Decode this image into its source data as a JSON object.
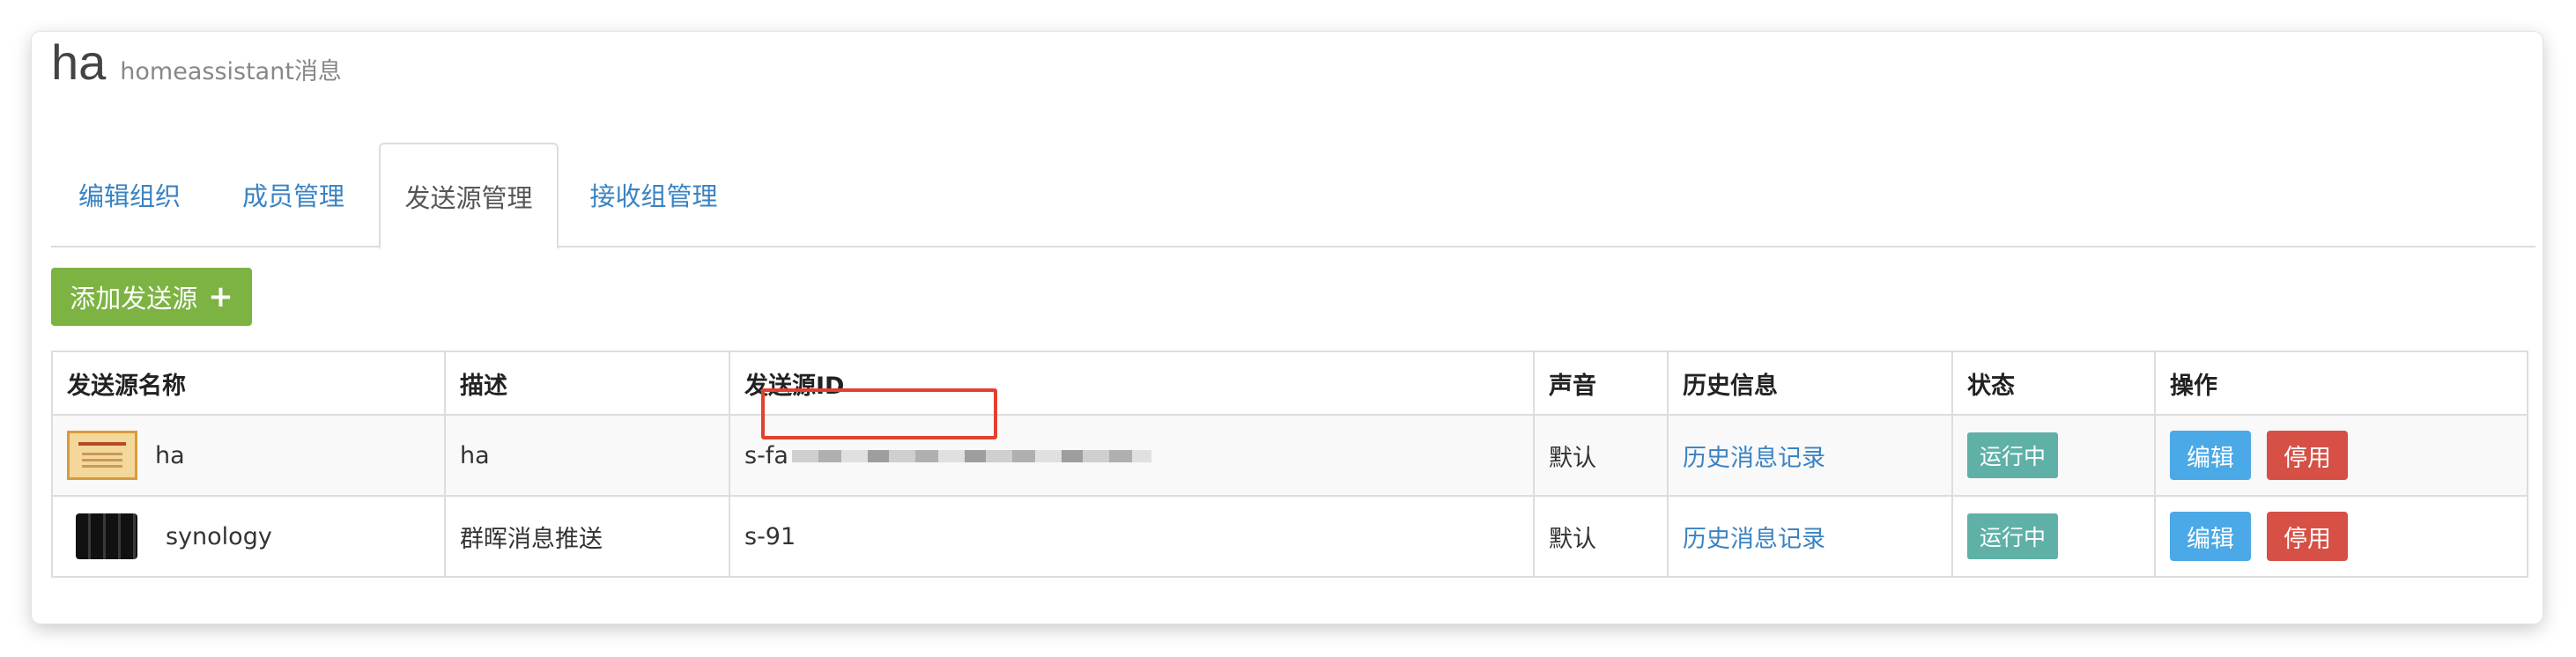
{
  "header": {
    "title": "ha",
    "subtitle": "homeassistant消息"
  },
  "tabs": [
    {
      "label": "编辑组织",
      "active": false
    },
    {
      "label": "成员管理",
      "active": false
    },
    {
      "label": "发送源管理",
      "active": true
    },
    {
      "label": "接收组管理",
      "active": false
    }
  ],
  "toolbar": {
    "add_label": "添加发送源",
    "add_icon": "+"
  },
  "table": {
    "columns": [
      "发送源名称",
      "描述",
      "发送源ID",
      "声音",
      "历史信息",
      "状态",
      "操作"
    ],
    "rows": [
      {
        "name": "ha",
        "icon": "certificate-icon",
        "description": "ha",
        "source_id": "s-fa",
        "sound": "默认",
        "history": "历史消息记录",
        "status": "运行中",
        "edit": "编辑",
        "disable": "停用"
      },
      {
        "name": "synology",
        "icon": "nas-icon",
        "description": "群晖消息推送",
        "source_id": "s-91",
        "sound": "默认",
        "history": "历史消息记录",
        "status": "运行中",
        "edit": "编辑",
        "disable": "停用"
      }
    ]
  },
  "colors": {
    "accent": "#3a83c2",
    "add_button": "#7cb342",
    "status": "#5fb1a8",
    "edit": "#4aa9e6",
    "disable": "#d65045",
    "highlight": "#e2412f"
  }
}
